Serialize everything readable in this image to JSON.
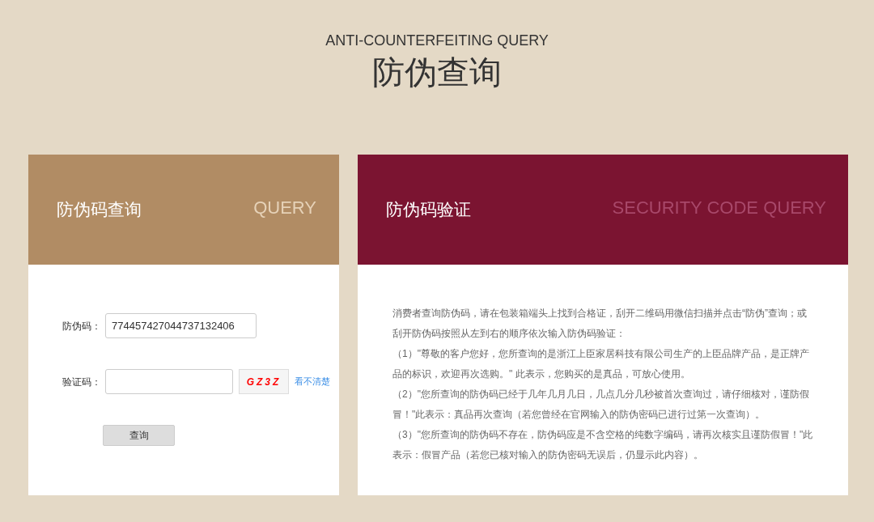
{
  "page_header": {
    "subtitle": "ANTI-COUNTERFEITING QUERY",
    "title": "防伪查询"
  },
  "query_panel": {
    "title": "防伪码查询",
    "title_en": "QUERY",
    "code_field": {
      "label": "防伪码：",
      "value": "774457427044737132406"
    },
    "captcha_field": {
      "label": "验证码："
    },
    "captcha_image": "GZ3Z",
    "refresh_link": "看不清楚",
    "submit_button": "查询"
  },
  "verify_panel": {
    "title": "防伪码验证",
    "title_en": "SECURITY CODE QUERY",
    "paragraphs": [
      "消费者查询防伪码，请在包装箱端头上找到合格证，刮开二维码用微信扫描并点击“防伪”查询；或刮开防伪码按照从左到右的顺序依次输入防伪码验证：",
      "（1）\"尊敬的客户您好，您所查询的是浙江上臣家居科技有限公司生产的上臣品牌产品，是正牌产品的标识，欢迎再次选购。\" 此表示，您购买的是真品，可放心使用。",
      "（2）\"您所查询的防伪码已经于几年几月几日，几点几分几秒被首次查询过，请仔细核对，谨防假冒！\"此表示：真品再次查询（若您曾经在官网输入的防伪密码已进行过第一次查询）。",
      "（3）\"您所查询的防伪码不存在，防伪码应是不含空格的纯数字编码，请再次核实且谨防假冒！\"此表示：假冒产品（若您已核对输入的防伪密码无误后，仍显示此内容）。"
    ]
  }
}
